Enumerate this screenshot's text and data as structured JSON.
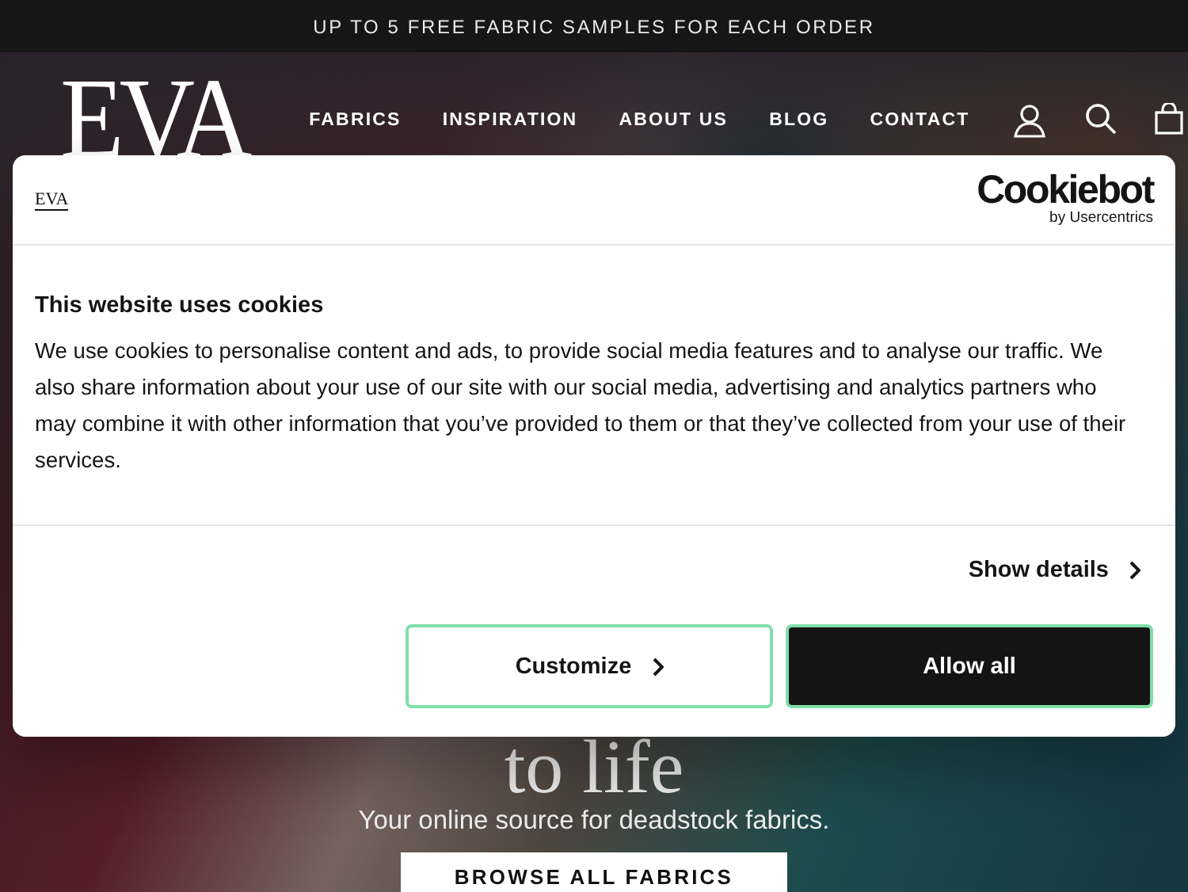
{
  "announcement": "UP TO 5 FREE FABRIC SAMPLES FOR EACH ORDER",
  "logo": "EVA",
  "nav": [
    "FABRICS",
    "INSPIRATION",
    "ABOUT US",
    "BLOG",
    "CONTACT"
  ],
  "hero": {
    "heading": "to life",
    "subtitle": "Your online source for deadstock fabrics.",
    "button": "BROWSE ALL FABRICS"
  },
  "cookie_dialog": {
    "logo": "EVA",
    "brand": "Cookiebot",
    "brand_sub": "by Usercentrics",
    "title": "This website uses cookies",
    "body": "We use cookies to personalise content and ads, to provide social media features and to analyse our traffic. We also share information about your use of our site with our social media, advertising and analytics partners who may combine it with other information that you’ve provided to them or that they’ve collected from your use of their services.",
    "show_details": "Show details",
    "buttons": [
      {
        "label": "Customize",
        "kind": "outline"
      },
      {
        "label": "Allow all",
        "kind": "primary"
      }
    ]
  }
}
